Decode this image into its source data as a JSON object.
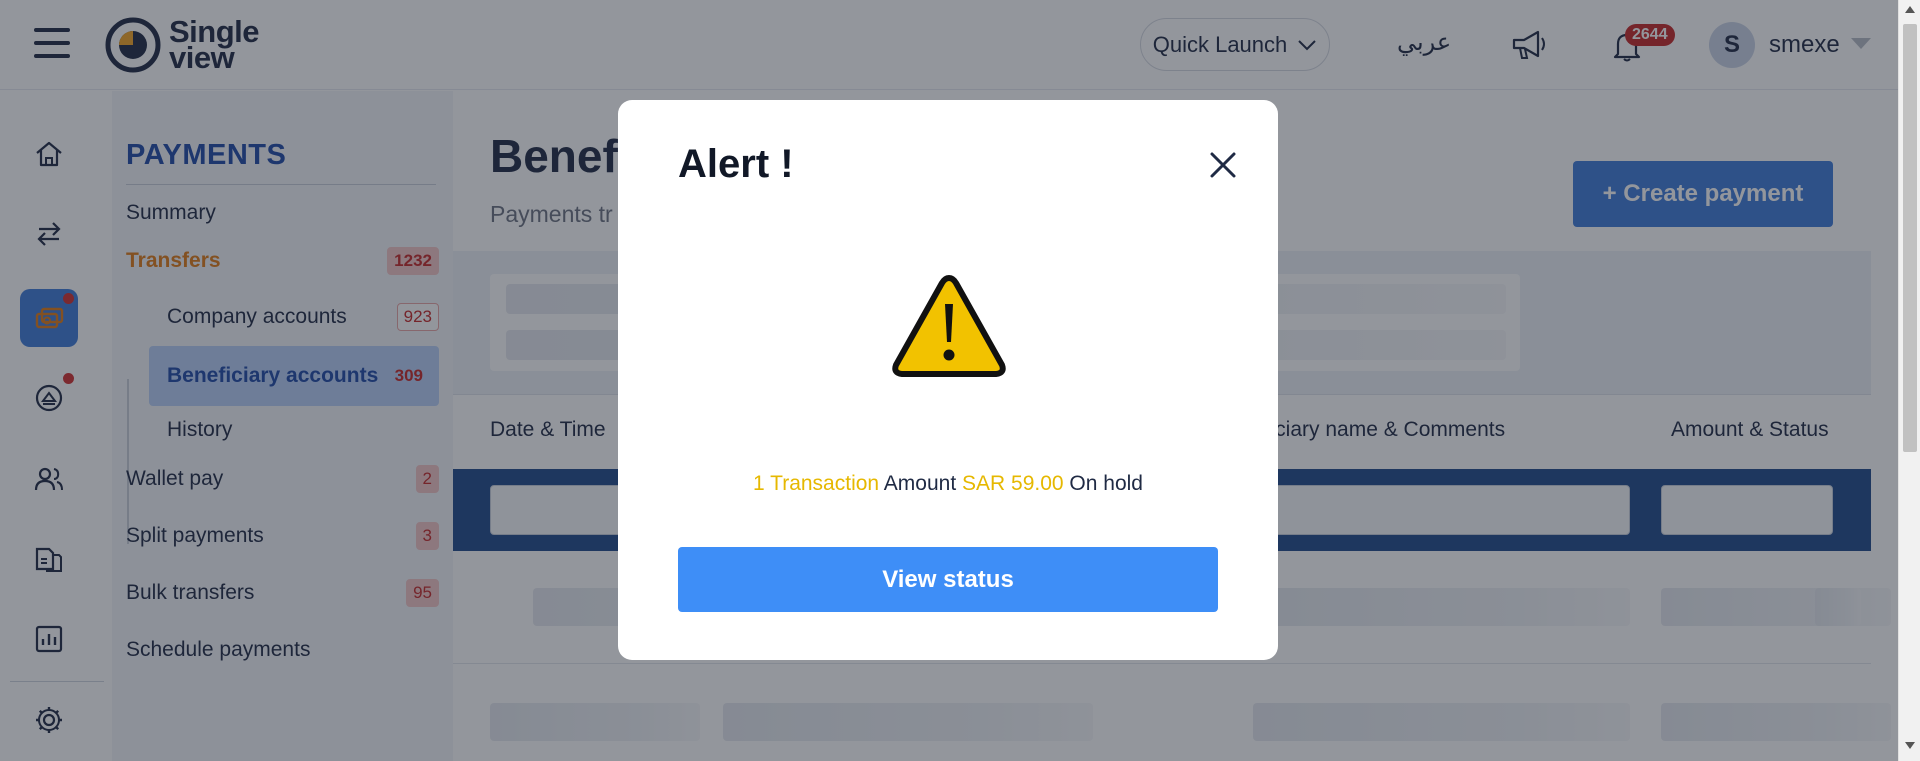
{
  "header": {
    "logo_line1": "Single",
    "logo_line2": "view",
    "quick_launch_label": "Quick Launch",
    "language_label": "عربي",
    "notification_count": "2644",
    "avatar_initial": "S",
    "username": "smexe"
  },
  "rail": {
    "items": [
      {
        "icon": "home-icon"
      },
      {
        "icon": "transfer-arrows-icon"
      },
      {
        "icon": "payments-icon",
        "active": true,
        "dot": true
      },
      {
        "icon": "savings-icon",
        "dot": true
      },
      {
        "icon": "users-icon"
      },
      {
        "icon": "documents-icon"
      },
      {
        "icon": "reports-chart-icon"
      },
      {
        "icon": "settings-gear-icon"
      }
    ]
  },
  "subnav": {
    "title": "PAYMENTS",
    "items": [
      {
        "label": "Summary"
      },
      {
        "label": "Transfers",
        "count": "1232"
      },
      {
        "label": "Company accounts",
        "count": "923"
      },
      {
        "label": "Beneficiary accounts",
        "count": "309"
      },
      {
        "label": "History"
      },
      {
        "label": "Wallet pay",
        "count": "2"
      },
      {
        "label": "Split payments",
        "count": "3"
      },
      {
        "label": "Bulk transfers",
        "count": "95"
      },
      {
        "label": "Schedule payments"
      }
    ]
  },
  "main": {
    "title": "Benefi",
    "subtitle": "Payments tr",
    "create_button": "+ Create payment",
    "columns": {
      "date_time": "Date & Time",
      "beneficiary": "eficiary name & Comments",
      "amount_status": "Amount & Status"
    }
  },
  "modal": {
    "title": "Alert !",
    "message": {
      "count": "1 Transaction",
      "amount_label": "Amount",
      "amount_value": "SAR 59.00",
      "status": "On hold"
    },
    "button": "View status"
  },
  "colors": {
    "primary": "#3e7bd9",
    "accent_orange": "#e07b16",
    "highlight_yellow": "#e6b800",
    "badge_red": "#c62828",
    "warning_yellow": "#f2c200"
  }
}
